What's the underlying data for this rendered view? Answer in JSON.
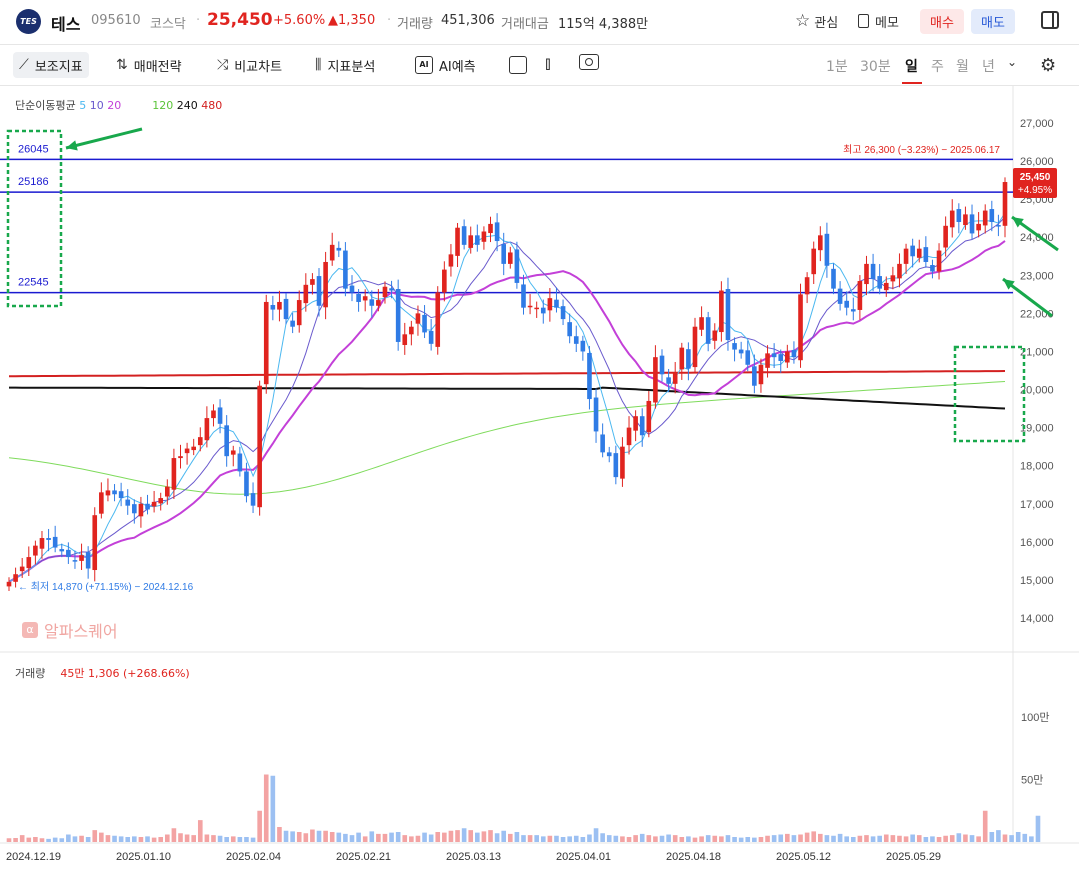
{
  "header": {
    "logo_text": "TES",
    "name": "테스",
    "code": "095610",
    "market": "코스닥",
    "price": "25,450",
    "change_pct": "+5.60%",
    "change_abs": "▲1,350",
    "volume_label": "거래량",
    "volume_value": "451,306",
    "amount_label": "거래대금",
    "amount_value": "115억 4,388만",
    "watch_label": "관심",
    "memo_label": "메모",
    "buy_label": "매수",
    "sell_label": "매도"
  },
  "toolbar": {
    "indicator_label": "보조지표",
    "strategy_label": "매매전략",
    "compare_label": "비교차트",
    "analysis_label": "지표분석",
    "ai_label": "AI예측",
    "periods": [
      "1분",
      "30분",
      "일",
      "주",
      "월",
      "년"
    ],
    "selected_period": "일"
  },
  "legend": {
    "ma_title": "단순이동평균",
    "ma5": "5",
    "ma10": "10",
    "ma20": "20",
    "ma120": "120",
    "ma240": "240",
    "ma480": "480",
    "volume_title": "거래량",
    "volume_info": "45만 1,306 (+268.66%)",
    "watermark": "알파스퀘어"
  },
  "annotations": {
    "high": "최고 26,300 (−3.23%) − 2025.06.17",
    "low": "최저 14,870 (+71.15%) − 2024.12.16",
    "price_tag": "25,450",
    "price_tag_pct": "+4.95%",
    "level_labels": [
      "26045",
      "25186",
      "22545"
    ]
  },
  "colors": {
    "up": "#e0241f",
    "down": "#2f7be5",
    "vol_up": "#f3a3a3",
    "vol_down": "#9cc0f2",
    "ma5": "#4bb8f0",
    "ma10": "#6a5acd",
    "ma20": "#c340d8",
    "ma120": "#7fdb5c",
    "ma240": "#111111",
    "ma480": "#d32020",
    "hline": "#1a1ad0",
    "box": "#18a84c"
  },
  "chart_data": {
    "type": "candlestick",
    "price_ticks": [
      "27,000",
      "26,000",
      "25,000",
      "24,000",
      "23,000",
      "22,000",
      "21,000",
      "20,000",
      "19,000",
      "18,000",
      "17,000",
      "16,000",
      "15,000",
      "14,000"
    ],
    "volume_ticks": [
      "100만",
      "50만"
    ],
    "x_labels": [
      "2024.12.19",
      "2025.01.10",
      "2025.02.04",
      "2025.02.21",
      "2025.03.13",
      "2025.04.01",
      "2025.04.18",
      "2025.05.12",
      "2025.05.29"
    ],
    "horizontal_levels": [
      26045,
      25186,
      22545
    ],
    "ma_labels": [
      "5",
      "10",
      "20",
      "120",
      "240",
      "480"
    ],
    "close": [
      14950,
      15150,
      15350,
      15600,
      15900,
      16100,
      16050,
      15850,
      15750,
      15600,
      15500,
      15650,
      15300,
      16700,
      17300,
      17350,
      17250,
      17150,
      16950,
      16750,
      17000,
      16850,
      17050,
      17150,
      17450,
      18200,
      18250,
      18450,
      18500,
      18750,
      19250,
      19450,
      19100,
      18250,
      18400,
      17850,
      17200,
      16950,
      20100,
      22300,
      22100,
      22300,
      21850,
      21650,
      22350,
      22750,
      22900,
      22200,
      23350,
      23800,
      23650,
      22650,
      22550,
      22300,
      22450,
      22200,
      22350,
      22700,
      22600,
      21250,
      21450,
      21650,
      22000,
      21500,
      21200,
      22550,
      23150,
      23550,
      24250,
      23800,
      24050,
      23800,
      24150,
      24350,
      23900,
      23300,
      23600,
      22800,
      22150,
      22200,
      22150,
      22000,
      22400,
      22150,
      21850,
      21400,
      21200,
      21000,
      19750,
      18900,
      18350,
      18250,
      17700,
      18500,
      19000,
      19300,
      18800,
      19700,
      20850,
      20400,
      20150,
      20450,
      21100,
      20550,
      21650,
      21900,
      21200,
      21550,
      22600,
      21300,
      21050,
      20950,
      20650,
      20100,
      20650,
      20950,
      20850,
      20750,
      21000,
      20850,
      22500,
      22950,
      23700,
      24050,
      23250,
      22650,
      22250,
      22150,
      22050,
      22850,
      23300,
      22900,
      22650,
      22800,
      23000,
      23300,
      23700,
      23500,
      23700,
      23350,
      23100,
      23650,
      24300,
      24700,
      24400,
      24600,
      24100,
      24350,
      24700,
      24400,
      24300,
      25450
    ],
    "volume_k": [
      30,
      32,
      55,
      35,
      40,
      30,
      25,
      35,
      30,
      60,
      45,
      50,
      40,
      95,
      75,
      55,
      50,
      45,
      40,
      45,
      40,
      45,
      35,
      40,
      60,
      110,
      70,
      60,
      55,
      175,
      60,
      55,
      50,
      40,
      45,
      40,
      40,
      35,
      250,
      540,
      530,
      120,
      90,
      85,
      80,
      70,
      100,
      90,
      90,
      80,
      75,
      65,
      55,
      75,
      45,
      85,
      65,
      65,
      75,
      80,
      55,
      45,
      50,
      75,
      60,
      80,
      75,
      90,
      95,
      110,
      95,
      75,
      85,
      95,
      70,
      90,
      65,
      80,
      55,
      55,
      55,
      45,
      50,
      50,
      40,
      45,
      50,
      40,
      60,
      110,
      70,
      55,
      50,
      45,
      40,
      55,
      65,
      55,
      45,
      50,
      60,
      55,
      40,
      45,
      35,
      45,
      55,
      50,
      45,
      55,
      40,
      35,
      40,
      35,
      40,
      50,
      55,
      60,
      65,
      55,
      60,
      75,
      85,
      65,
      55,
      50,
      65,
      45,
      40,
      50,
      55,
      45,
      50,
      60,
      55,
      50,
      45,
      60,
      55,
      40,
      45,
      40,
      50,
      55,
      70,
      60,
      55,
      45,
      250,
      80,
      95,
      60,
      55,
      80,
      65,
      45,
      210
    ]
  }
}
